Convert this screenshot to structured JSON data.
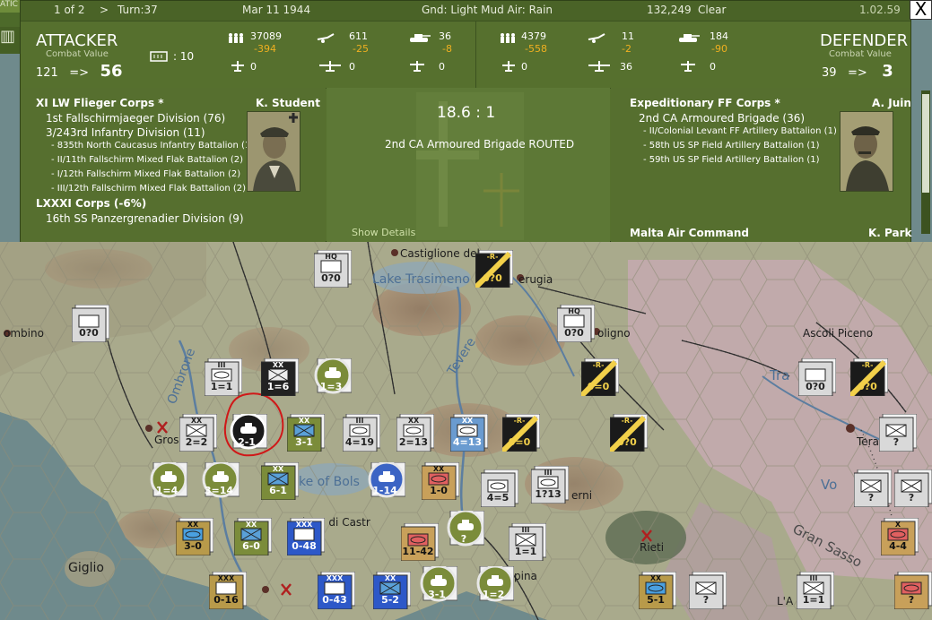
{
  "top": {
    "page": "1 of 2",
    "turn": "Turn:37",
    "date": "Mar 11 1944",
    "ground": "Gnd: Light Mud  Air: Rain",
    "score": "132,249",
    "weather": "Clear",
    "version": "1.02.59",
    "close": "X"
  },
  "attacker": {
    "title": "ATTACKER",
    "cv_label": "Combat Value",
    "cv_from": "121",
    "cv_arrow": "=>",
    "cv_to": "56",
    "fort": ": 10",
    "men": "37089",
    "men_loss": "-394",
    "guns": "611",
    "guns_loss": "-25",
    "tanks": "36",
    "tanks_loss": "-8",
    "ftr": "0",
    "bmb": "0",
    "trn": "0"
  },
  "defender": {
    "title": "DEFENDER",
    "cv_label": "Combat Value",
    "cv_from": "39",
    "cv_arrow": "=>",
    "cv_to": "3",
    "men": "4379",
    "men_loss": "-558",
    "guns": "11",
    "guns_loss": "-2",
    "tanks": "184",
    "tanks_loss": "-90",
    "ftr": "0",
    "bmb": "36",
    "trn": "0"
  },
  "att_units": {
    "hq": "XI LW Flieger Corps *",
    "commander": "K. Student",
    "lines": [
      "1st Fallschirmjaeger Division (76)",
      "3/243rd Infantry Division (11)",
      "- 835th North Caucasus Infantry Battalion (1)",
      "- II/11th Fallschirm Mixed Flak Battalion (2)",
      "- I/12th Fallschirm Mixed Flak Battalion (2)",
      "- III/12th Fallschirm Mixed Flak Battalion (2)",
      "LXXXI Corps (-6%)",
      "16th SS Panzergrenadier Division (9)"
    ]
  },
  "result": {
    "odds": "18.6 : 1",
    "text": "2nd CA Armoured Brigade ROUTED",
    "details": "Show Details"
  },
  "def_units": {
    "hq": "Expeditionary FF Corps *",
    "commander": "A. Juin",
    "lines": [
      "2nd CA Armoured Brigade (36)",
      "- II/Colonial Levant FF Artillery Battalion (1)",
      "- 58th US SP Field Artillery Battalion (1)",
      "- 59th US SP Field Artillery Battalion (1)"
    ],
    "footer_left": "Malta Air Command",
    "footer_right": "K. Park"
  },
  "map_labels": {
    "castiglione": "Castiglione del",
    "trasimeno": "Lake Trasimeno",
    "perugia": "erugia",
    "piombino": "ombino",
    "foligno": "oligno",
    "ascoli": "Ascoli Piceno",
    "grosseto": "Gros",
    "bolsena": "ke of Bols",
    "orbetello": "rlena di Castr",
    "terni": "erni",
    "rieti": "Rieti",
    "gransasso": "Gran Sasso",
    "giglio": "Giglio",
    "aquila": "L'A",
    "tera": "Tera",
    "tr": "Tra",
    "vo": "Vo",
    "tevere": "Tevere",
    "ombrone": "Ombrone",
    "pina": "pina"
  },
  "counters": [
    {
      "label": "0?0",
      "size": "HQ",
      "kind": "hq",
      "name": "hq-counter-castiglione"
    },
    {
      "label": "0?0",
      "size": "-R-",
      "kind": "rail",
      "name": "rail-counter-perugia"
    },
    {
      "label": "0?0",
      "size": "",
      "kind": "unknown",
      "name": "unknown-counter-piombino"
    },
    {
      "label": "0?0",
      "size": "HQ",
      "kind": "hq",
      "name": "hq-counter-foligno"
    },
    {
      "label": "1=1",
      "size": "III",
      "kind": "mech",
      "name": "unit-counter-1-1a"
    },
    {
      "label": "1=6",
      "size": "XX",
      "kind": "inf-black",
      "name": "unit-counter-1-6"
    },
    {
      "label": "1=3",
      "size": "",
      "kind": "armor-round",
      "name": "unit-counter-1-3"
    },
    {
      "label": "0=0",
      "size": "-R-",
      "kind": "rail",
      "name": "rail-counter-0-0a"
    },
    {
      "label": "0?0",
      "size": "",
      "kind": "unknown",
      "name": "unknown-counter-ascoli"
    },
    {
      "label": "0?0",
      "size": "-R-",
      "kind": "rail",
      "name": "rail-counter-ascoli"
    },
    {
      "label": "2=2",
      "size": "XX",
      "kind": "inf",
      "name": "unit-counter-2-2"
    },
    {
      "label": "2-1",
      "size": "",
      "kind": "armor-sel",
      "name": "selected-armor-counter"
    },
    {
      "label": "3-1",
      "size": "XX",
      "kind": "inf-green",
      "name": "unit-counter-3-1a"
    },
    {
      "label": "4=19",
      "size": "III",
      "kind": "mech",
      "name": "unit-counter-4-19"
    },
    {
      "label": "2=13",
      "size": "XX",
      "kind": "mech",
      "name": "unit-counter-2-13"
    },
    {
      "label": "4=13",
      "size": "XX",
      "kind": "mech-blue",
      "name": "unit-counter-4-13"
    },
    {
      "label": "0=0",
      "size": "-R-",
      "kind": "rail",
      "name": "rail-counter-0-0b"
    },
    {
      "label": "0?0",
      "size": "-R-",
      "kind": "rail",
      "name": "rail-counter-0-0c"
    },
    {
      "label": "?",
      "size": "",
      "kind": "inf",
      "name": "unknown-counter-tera"
    },
    {
      "label": "1=4",
      "size": "",
      "kind": "armor-round",
      "name": "unit-counter-1-4"
    },
    {
      "label": "3=14",
      "size": "",
      "kind": "armor-round",
      "name": "unit-counter-3-14"
    },
    {
      "label": "6-1",
      "size": "XX",
      "kind": "inf-green",
      "name": "unit-counter-6-1"
    },
    {
      "label": "1-14",
      "size": "",
      "kind": "armor-blue",
      "name": "unit-counter-1-14"
    },
    {
      "label": "1-0",
      "size": "XX",
      "kind": "mech-red",
      "name": "unit-counter-1-0"
    },
    {
      "label": "4=5",
      "size": "",
      "kind": "mech",
      "name": "unit-counter-4-5"
    },
    {
      "label": "1?13",
      "size": "III",
      "kind": "mech",
      "name": "unit-counter-1-13"
    },
    {
      "label": "?",
      "size": "",
      "kind": "inf",
      "name": "unknown-counter-vo"
    },
    {
      "label": "?",
      "size": "",
      "kind": "inf",
      "name": "unknown-counter-vo2"
    },
    {
      "label": "3-0",
      "size": "XX",
      "kind": "mech-tan",
      "name": "unit-counter-3-0"
    },
    {
      "label": "6-0",
      "size": "XX",
      "kind": "inf-green",
      "name": "unit-counter-6-0"
    },
    {
      "label": "0-48",
      "size": "XXX",
      "kind": "hq-blue",
      "name": "hq-counter-0-48"
    },
    {
      "label": "11-42",
      "size": "",
      "kind": "mech-red",
      "name": "unit-counter-11-42"
    },
    {
      "label": "?",
      "size": "",
      "kind": "armor-round",
      "name": "unit-counter-armor-round"
    },
    {
      "label": "1=1",
      "size": "III",
      "kind": "inf",
      "name": "unit-counter-1-1b"
    },
    {
      "label": "4-4",
      "size": "X",
      "kind": "mech-red",
      "name": "unit-counter-4-4"
    },
    {
      "label": "0-16",
      "size": "XXX",
      "kind": "arty-tan",
      "name": "hq-counter-0-16"
    },
    {
      "label": "0-43",
      "size": "XXX",
      "kind": "hq-blue",
      "name": "hq-counter-0-43"
    },
    {
      "label": "5-2",
      "size": "XX",
      "kind": "inf-blue",
      "name": "unit-counter-5-2"
    },
    {
      "label": "3-1",
      "size": "",
      "kind": "armor-round",
      "name": "unit-counter-3-1b"
    },
    {
      "label": "1=2",
      "size": "",
      "kind": "armor-round",
      "name": "unit-counter-1-2"
    },
    {
      "label": "5-1",
      "size": "XX",
      "kind": "mech-tan",
      "name": "unit-counter-5-1"
    },
    {
      "label": "?",
      "size": "",
      "kind": "inf",
      "name": "unknown-counter-rieti"
    },
    {
      "label": "1=1",
      "size": "III",
      "kind": "inf",
      "name": "unit-counter-1-1c"
    },
    {
      "label": "?",
      "size": "",
      "kind": "mech-red",
      "name": "unit-counter-edge"
    }
  ],
  "colors": {
    "panel": "#56702e",
    "loss": "#f0b020",
    "sea": "#6f8a8c",
    "land": "#a9aa8c"
  }
}
